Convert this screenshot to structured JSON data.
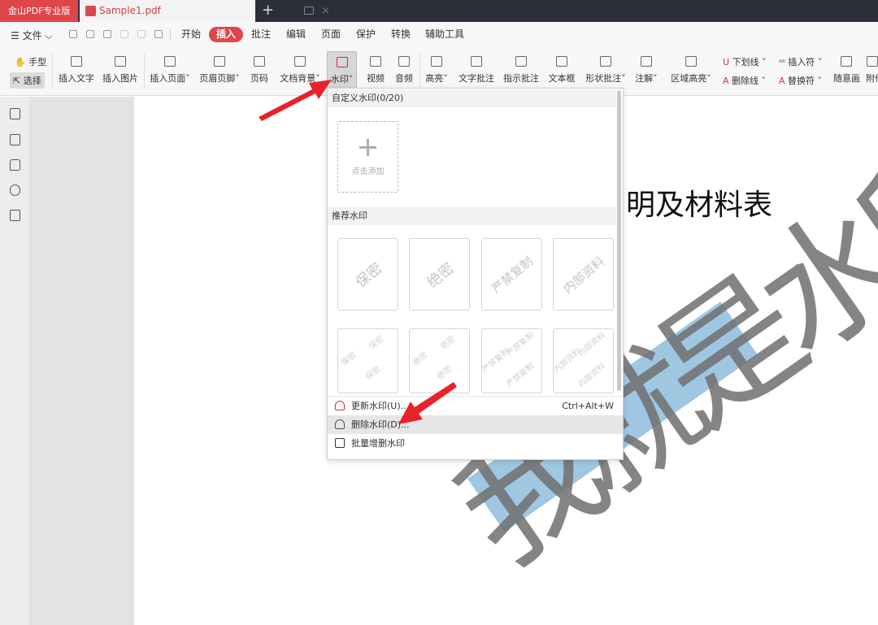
{
  "titlebar": {
    "app_tab": "金山PDF专业版",
    "doc_tab": "Sample1.pdf",
    "close": "×",
    "new_tab": "+"
  },
  "menubar": {
    "file": "☰ 文件 ⌵",
    "tabs": [
      "开始",
      "插入",
      "批注",
      "编辑",
      "页面",
      "保护",
      "转换",
      "辅助工具"
    ],
    "active_tab": "插入"
  },
  "ribbon": {
    "hand": "手型",
    "select": "选择",
    "items": [
      "插入文字",
      "插入图片",
      "插入页面˅",
      "页眉页脚˅",
      "页码",
      "文档背景˅",
      "水印˅",
      "视频",
      "音频",
      "高亮˅",
      "文字批注",
      "指示批注",
      "文本框",
      "形状批注˅",
      "注解˅",
      "区域高亮˅"
    ],
    "small": {
      "underline": "下划线 ˅",
      "insert_mark": "插入符 ˅",
      "strike": "删除线 ˅",
      "replace_mark": "替换符 ˅",
      "freehand": "随意画",
      "attach": "附件"
    }
  },
  "page": {
    "title": "明及材料表",
    "watermark": "我就是水印"
  },
  "dropdown": {
    "custom_header": "自定义水印(0/20)",
    "add_label": "点击添加",
    "recommended_header": "推荐水印",
    "cards": [
      "保密",
      "绝密",
      "严禁复制",
      "内部资料"
    ],
    "tiles": [
      "保密",
      "绝密",
      "严禁复制",
      "内部资料"
    ],
    "menu": [
      {
        "label": "更新水印(U)...",
        "shortcut": "Ctrl+Alt+W"
      },
      {
        "label": "删除水印(D)...",
        "shortcut": ""
      },
      {
        "label": "批量增删水印",
        "shortcut": ""
      }
    ]
  },
  "colors": {
    "accent": "#e0454b",
    "titlebar": "#2b2f3a",
    "watermark_band": "#8fbddd"
  }
}
